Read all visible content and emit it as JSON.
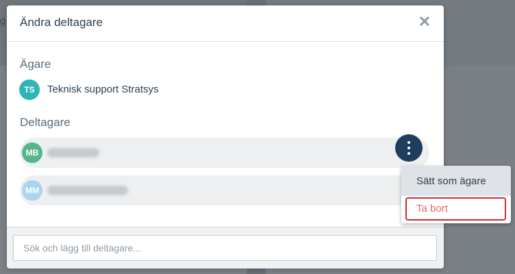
{
  "background": {
    "partial_letter": "g"
  },
  "modal": {
    "title": "Ändra deltagare",
    "close_icon": "close-icon"
  },
  "owner_section": {
    "title": "Ägare",
    "owner": {
      "initials": "TS",
      "name": "Teknisk support Stratsys",
      "avatar_color": "#2fb5b3"
    }
  },
  "participants_section": {
    "title": "Deltagare",
    "participants": [
      {
        "initials": "MB",
        "avatar_color": "#57b58a"
      },
      {
        "initials": "MM",
        "avatar_color": "#a9d5ee"
      }
    ]
  },
  "context_menu": {
    "items": [
      {
        "label": "Sätt som ägare"
      },
      {
        "label": "Ta bort"
      }
    ]
  },
  "search": {
    "placeholder": "Sök och lägg till deltagare..."
  }
}
